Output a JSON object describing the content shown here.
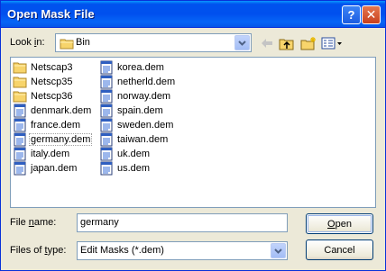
{
  "window": {
    "title": "Open Mask File"
  },
  "titlebar": {
    "help_glyph": "?",
    "close_glyph": "✕"
  },
  "look_in": {
    "label_pre": "Look ",
    "label_key": "i",
    "label_post": "n:",
    "value": "Bin"
  },
  "toolbar": {
    "icons": [
      "back-arrow-icon",
      "up-folder-icon",
      "new-folder-icon",
      "view-menu-icon"
    ]
  },
  "files": {
    "column1": [
      {
        "name": "Netscap3",
        "icon": "folder-icon"
      },
      {
        "name": "Netscp35",
        "icon": "folder-icon"
      },
      {
        "name": "Netscp36",
        "icon": "folder-icon"
      },
      {
        "name": "denmark.dem",
        "icon": "dem-file-icon"
      },
      {
        "name": "france.dem",
        "icon": "dem-file-icon"
      },
      {
        "name": "germany.dem",
        "icon": "dem-file-icon",
        "selected": true
      },
      {
        "name": "italy.dem",
        "icon": "dem-file-icon"
      },
      {
        "name": "japan.dem",
        "icon": "dem-file-icon"
      }
    ],
    "column2": [
      {
        "name": "korea.dem",
        "icon": "dem-file-icon"
      },
      {
        "name": "netherld.dem",
        "icon": "dem-file-icon"
      },
      {
        "name": "norway.dem",
        "icon": "dem-file-icon"
      },
      {
        "name": "spain.dem",
        "icon": "dem-file-icon"
      },
      {
        "name": "sweden.dem",
        "icon": "dem-file-icon"
      },
      {
        "name": "taiwan.dem",
        "icon": "dem-file-icon"
      },
      {
        "name": "uk.dem",
        "icon": "dem-file-icon"
      },
      {
        "name": "us.dem",
        "icon": "dem-file-icon"
      }
    ]
  },
  "file_name": {
    "label_pre": "File ",
    "label_key": "n",
    "label_post": "ame:",
    "value": "germany"
  },
  "file_type": {
    "label_pre": "Files of ",
    "label_key": "t",
    "label_post": "ype:",
    "value": "Edit Masks (*.dem)"
  },
  "buttons": {
    "open_key": "O",
    "open_rest": "pen",
    "cancel": "Cancel"
  },
  "colors": {
    "accent": "#0053ee",
    "face": "#ece9d8",
    "border": "#7f9db9"
  }
}
